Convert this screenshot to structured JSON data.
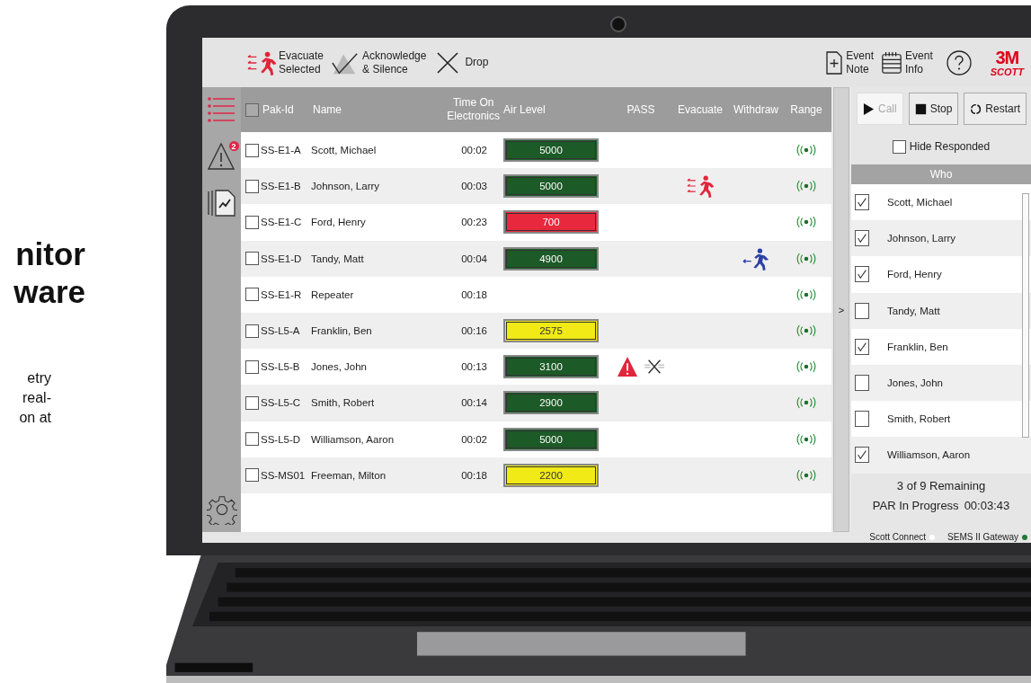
{
  "marketing": {
    "heading_lines": [
      "nitor",
      "ware"
    ],
    "body_lines": [
      "etry",
      "real-",
      "on at"
    ]
  },
  "toolbar": {
    "actions": [
      {
        "kind": "evacuate",
        "lines": [
          "Evacuate",
          "Selected"
        ]
      },
      {
        "kind": "acknowledge",
        "lines": [
          "Acknowledge",
          "& Silence"
        ]
      },
      {
        "kind": "drop",
        "lines": [
          "Drop"
        ]
      }
    ],
    "tools": [
      {
        "kind": "note",
        "lines": [
          "Event",
          "Note"
        ]
      },
      {
        "kind": "info",
        "lines": [
          "Event",
          "Info"
        ]
      },
      {
        "kind": "help"
      }
    ],
    "logo": {
      "brand": "3M",
      "sub": "SCOTT"
    }
  },
  "sidebar": {
    "items": [
      {
        "kind": "list",
        "selected": true
      },
      {
        "kind": "alerts",
        "selected": false,
        "badge": "2"
      },
      {
        "kind": "report",
        "selected": false
      }
    ]
  },
  "table": {
    "select_all_checked": false,
    "columns": [
      {
        "kind": "check"
      },
      {
        "kind": "id",
        "lines": [
          "Pak-Id"
        ]
      },
      {
        "kind": "name",
        "lines": [
          "Name"
        ]
      },
      {
        "kind": "time",
        "lines": [
          "Time On",
          "Electronics"
        ]
      },
      {
        "kind": "air",
        "lines": [
          "Air Level"
        ]
      },
      {
        "kind": "pass",
        "lines": [
          "PASS"
        ]
      },
      {
        "kind": "evac",
        "lines": [
          "Evacuate"
        ]
      },
      {
        "kind": "withdraw",
        "lines": [
          "Withdraw"
        ]
      },
      {
        "kind": "range",
        "lines": [
          "Range"
        ]
      }
    ],
    "rows": [
      {
        "checked": false,
        "pak_id": "SS-E1-A",
        "name": "Scott, Michael",
        "time": "00:02",
        "air": "5000",
        "color": "#1c5a27",
        "pass_alarm": false,
        "dropped": false,
        "evacuate": false,
        "withdraw": false
      },
      {
        "checked": false,
        "pak_id": "SS-E1-B",
        "name": "Johnson, Larry",
        "time": "00:03",
        "air": "5000",
        "color": "#1c5a27",
        "pass_alarm": false,
        "dropped": false,
        "evacuate": true,
        "withdraw": false
      },
      {
        "checked": false,
        "pak_id": "SS-E1-C",
        "name": "Ford, Henry",
        "time": "00:23",
        "air": "700",
        "color": "#e8283d",
        "pass_alarm": false,
        "dropped": false,
        "evacuate": false,
        "withdraw": false
      },
      {
        "checked": false,
        "pak_id": "SS-E1-D",
        "name": "Tandy, Matt",
        "time": "00:04",
        "air": "4900",
        "color": "#1c5a27",
        "pass_alarm": false,
        "dropped": false,
        "evacuate": false,
        "withdraw": true
      },
      {
        "checked": false,
        "pak_id": "SS-E1-R",
        "name": "Repeater",
        "time": "00:18",
        "pass_alarm": false,
        "dropped": false,
        "evacuate": false,
        "withdraw": false
      },
      {
        "checked": false,
        "pak_id": "SS-L5-A",
        "name": "Franklin, Ben",
        "time": "00:16",
        "air": "2575",
        "color": "#f2ea16",
        "pass_alarm": false,
        "dropped": false,
        "evacuate": false,
        "withdraw": false
      },
      {
        "checked": false,
        "pak_id": "SS-L5-B",
        "name": "Jones, John",
        "time": "00:13",
        "air": "3100",
        "color": "#1c5a27",
        "pass_alarm": true,
        "dropped": true,
        "evacuate": false,
        "withdraw": false
      },
      {
        "checked": false,
        "pak_id": "SS-L5-C",
        "name": "Smith, Robert",
        "time": "00:14",
        "air": "2900",
        "color": "#1c5a27",
        "pass_alarm": false,
        "dropped": false,
        "evacuate": false,
        "withdraw": false
      },
      {
        "checked": false,
        "pak_id": "SS-L5-D",
        "name": "Williamson, Aaron",
        "time": "00:02",
        "air": "5000",
        "color": "#1c5a27",
        "pass_alarm": false,
        "dropped": false,
        "evacuate": false,
        "withdraw": false
      },
      {
        "checked": false,
        "pak_id": "SS-MS01",
        "name": "Freeman, Milton",
        "time": "00:18",
        "air": "2200",
        "color": "#f2ea16",
        "pass_alarm": false,
        "dropped": false,
        "evacuate": false,
        "withdraw": false
      }
    ]
  },
  "splitter": {
    "glyph": ">"
  },
  "par_panel": {
    "buttons": [
      {
        "kind": "play",
        "label": "Call",
        "disabled": true
      },
      {
        "kind": "stop",
        "label": "Stop",
        "disabled": false
      },
      {
        "kind": "restart",
        "label": "Restart",
        "disabled": false
      }
    ],
    "hide_responded": {
      "label": "Hide Responded",
      "checked": false
    },
    "who_header": "Who",
    "who": [
      {
        "name": "Scott, Michael",
        "checked": true
      },
      {
        "name": "Johnson, Larry",
        "checked": true
      },
      {
        "name": "Ford, Henry",
        "checked": true
      },
      {
        "name": "Tandy, Matt",
        "checked": false
      },
      {
        "name": "Franklin, Ben",
        "checked": true
      },
      {
        "name": "Jones, John",
        "checked": false
      },
      {
        "name": "Smith, Robert",
        "checked": false
      },
      {
        "name": "Williamson, Aaron",
        "checked": true
      }
    ],
    "remaining": "3 of 9 Remaining",
    "par_label": "PAR In Progress",
    "par_time": "00:03:43"
  },
  "status_bar": [
    {
      "label": "Scott Connect",
      "color": "#ffffff"
    },
    {
      "label": "SEMS II Gateway",
      "color": "#1f7a3a"
    }
  ]
}
